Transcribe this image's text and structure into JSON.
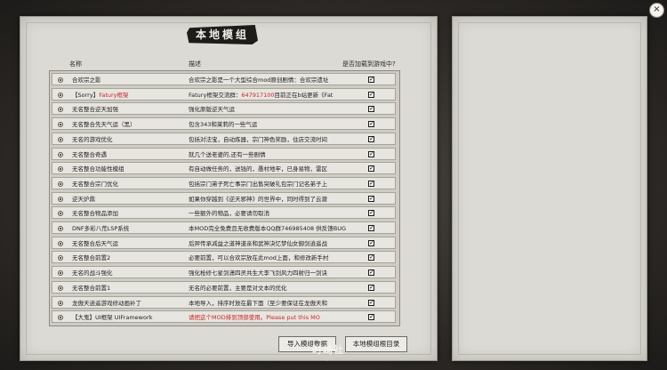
{
  "title": "本地模组",
  "headers": {
    "name": "名称",
    "description": "描述",
    "load": "是否加载到游戏中?"
  },
  "mods": [
    {
      "name": "合欢宗之影",
      "desc": "合欢宗之影是一个大型综合mod原创剧情：合欢宗遗址",
      "desc_red": "",
      "desc_tail": "",
      "checked": true
    },
    {
      "name": "【Sorry】",
      "name_red": "Fatury框架",
      "desc": "Fatury框架交流群：",
      "desc_red": "647917100",
      "desc_tail": "目前正在b站更新《Fat",
      "checked": true
    },
    {
      "name": "无名整合逆天加强",
      "desc": "强化原版逆天气运",
      "desc_red": "",
      "desc_tail": "",
      "checked": true
    },
    {
      "name": "无名整合先天气运（黑）",
      "desc": "包含343和莱莉的一些气运",
      "desc_red": "",
      "desc_tail": "",
      "checked": true
    },
    {
      "name": "无名的游戏优化",
      "desc": "包括对法宝，自动炼器，宗门神色奖励，住店交流时间",
      "desc_red": "",
      "desc_tail": "",
      "checked": true
    },
    {
      "name": "无名整合奇遇",
      "desc": "就几个送老婆的,还有一些剧情",
      "desc_red": "",
      "desc_tail": "",
      "checked": true
    },
    {
      "name": "无名整合功能性模组",
      "desc": "有自动做任务的，送钱的，愚村地牢，已身易物，雷区",
      "desc_red": "",
      "desc_tail": "",
      "checked": true
    },
    {
      "name": "无名整合宗门优化",
      "desc": "包括宗门弟子死亡事宗门出售突破礼包宗门记名弟子上",
      "desc_red": "",
      "desc_tail": "",
      "checked": true
    },
    {
      "name": "逆天炉鼎",
      "desc": "如果你穿越到《逆天邪神》的世界中，同时得到了云澈",
      "desc_red": "",
      "desc_tail": "",
      "checked": true
    },
    {
      "name": "无名整合物品添加",
      "desc": "一些额外的物品，必要请勿取消",
      "desc_red": "",
      "desc_tail": "",
      "checked": true
    },
    {
      "name": "DNF多彩八荒LSP系统",
      "desc": "本MOD完全免费且无收费版本QQ群746985408 供反馈BUG",
      "desc_red": "",
      "desc_tail": "",
      "checked": true
    },
    {
      "name": "无名整合后天气运",
      "desc": "后羿传承减益之道神道亲和武神决忆梦仙女御剑逍遥战",
      "desc_red": "",
      "desc_tail": "",
      "checked": true
    },
    {
      "name": "无名整合前置2",
      "desc": "必要前置，可以合欢宗放在此mod上面，和修改新手村",
      "desc_red": "",
      "desc_tail": "",
      "checked": true
    },
    {
      "name": "无名的战斗强化",
      "desc": "强化枪修七星剑潇四灵共生大李飞剑风力四射归一剑诀",
      "desc_red": "",
      "desc_tail": "",
      "checked": true
    },
    {
      "name": "无名整合前置1",
      "desc": "无名的必要前置，主要是对文本的优化",
      "desc_red": "",
      "desc_tail": "",
      "checked": true
    },
    {
      "name": "龙傲天逍遥游戏修动画补丁",
      "desc": "本地导入，排序时放在最下面（至少要保证在龙傲天和",
      "desc_red": "",
      "desc_tail": "",
      "checked": true
    },
    {
      "name": "【大鬼】UI框架 UIFramework",
      "desc": "",
      "desc_red": "请把这个MOD排到顶部使用。Please put this MO",
      "desc_tail": "",
      "checked": true
    }
  ],
  "buttons": {
    "import": "导入模组数据",
    "directory": "本地模组根目录"
  },
  "close_symbol": "×",
  "check_symbol": "✓",
  "watermark": "时崎社",
  "watermark_sub": "shiyj.me",
  "colors": {
    "accent_red": "#c9262a",
    "panel": "#dcdad4",
    "background": "#2a2724"
  }
}
